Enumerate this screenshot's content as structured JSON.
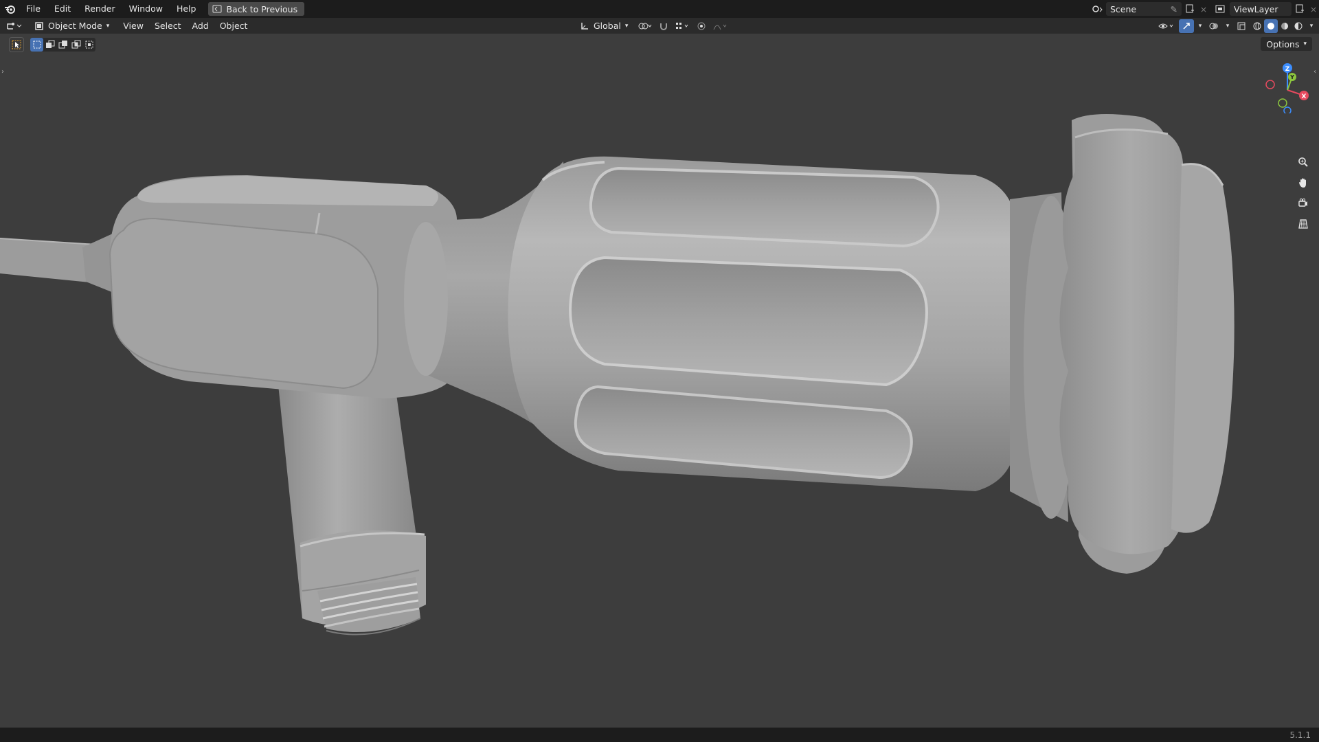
{
  "menu": {
    "items": [
      "File",
      "Edit",
      "Render",
      "Window",
      "Help"
    ],
    "back_button": "Back to Previous"
  },
  "scene": {
    "label": "Scene",
    "view_layer": "ViewLayer"
  },
  "header": {
    "mode": "Object Mode",
    "menus": [
      "View",
      "Select",
      "Add",
      "Object"
    ],
    "transform_orientation": "Global"
  },
  "viewport": {
    "options_label": "Options",
    "gizmo_axes": [
      "X",
      "Y",
      "Z"
    ],
    "background": "#3d3d3d",
    "object_color": "#a7a7a7"
  },
  "status": {
    "version": "5.1.1"
  },
  "colors": {
    "axis_x": "#e84a5f",
    "axis_y": "#8cc63e",
    "axis_z": "#3c8eff",
    "accent": "#4772b3"
  }
}
